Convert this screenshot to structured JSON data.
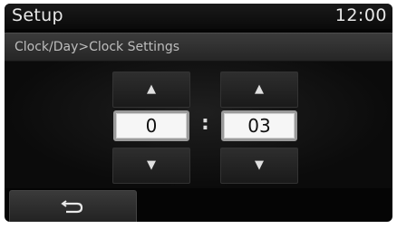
{
  "header": {
    "title": "Setup",
    "clock": "12:00"
  },
  "breadcrumb": "Clock/Day>Clock Settings",
  "time_setting": {
    "hour": "0",
    "separator": ":",
    "minute": "03",
    "up_icon": "up-arrow-icon",
    "down_icon": "down-arrow-icon"
  },
  "footer": {
    "back_icon": "back-arrow-icon"
  },
  "colors": {
    "background": "#050505",
    "header_text": "#e8e8e8",
    "breadcrumb_bar": "#2e2e2e",
    "value_box": "#f6f6f6"
  }
}
